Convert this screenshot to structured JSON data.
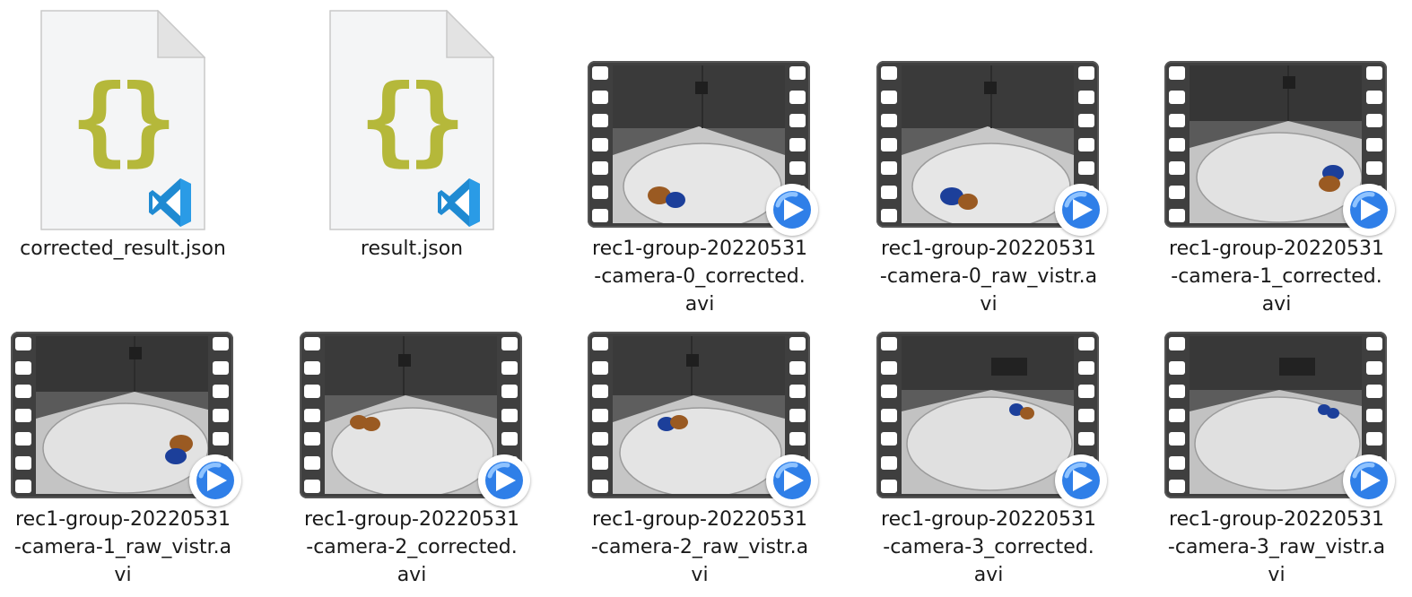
{
  "files": [
    {
      "id": "corrected-result-json",
      "type": "json",
      "label_lines": [
        "corrected_result.json"
      ]
    },
    {
      "id": "result-json",
      "type": "json",
      "label_lines": [
        "result.json"
      ]
    },
    {
      "id": "cam0-corrected",
      "type": "video",
      "label_lines": [
        "rec1-group-20220531",
        "-camera-0_corrected.",
        "avi"
      ]
    },
    {
      "id": "cam0-raw",
      "type": "video",
      "label_lines": [
        "rec1-group-20220531",
        "-camera-0_raw_vistr.a",
        "vi"
      ]
    },
    {
      "id": "cam1-corrected",
      "type": "video",
      "label_lines": [
        "rec1-group-20220531",
        "-camera-1_corrected.",
        "avi"
      ]
    },
    {
      "id": "cam1-raw",
      "type": "video",
      "label_lines": [
        "rec1-group-20220531",
        "-camera-1_raw_vistr.a",
        "vi"
      ]
    },
    {
      "id": "cam2-corrected",
      "type": "video",
      "label_lines": [
        "rec1-group-20220531",
        "-camera-2_corrected.",
        "avi"
      ]
    },
    {
      "id": "cam2-raw",
      "type": "video",
      "label_lines": [
        "rec1-group-20220531",
        "-camera-2_raw_vistr.a",
        "vi"
      ]
    },
    {
      "id": "cam3-corrected",
      "type": "video",
      "label_lines": [
        "rec1-group-20220531",
        "-camera-3_corrected.",
        "avi"
      ]
    },
    {
      "id": "cam3-raw",
      "type": "video",
      "label_lines": [
        "rec1-group-20220531",
        "-camera-3_raw_vistr.a",
        "vi"
      ]
    }
  ],
  "icons": {
    "json_file": "json-file-icon",
    "vscode_badge": "vscode-icon",
    "video_file": "video-thumbnail-icon",
    "player_badge": "video-player-icon"
  },
  "colors": {
    "json_braces": "#b5b83a",
    "vscode_blue": "#1f8ad2",
    "film_strip": "#3f3f3f",
    "player_blue": "#2f7fe8",
    "mouse_brown": "#9a5a22",
    "mouse_blue": "#1c3f9a"
  }
}
